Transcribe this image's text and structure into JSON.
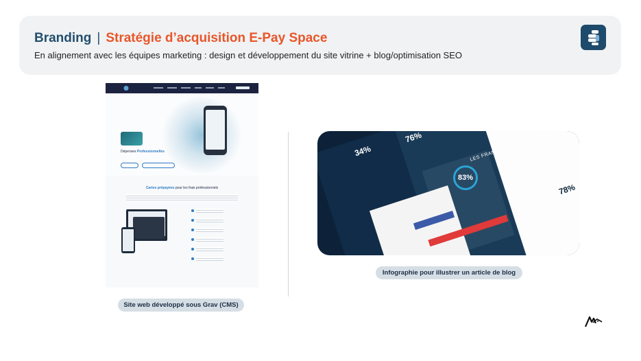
{
  "header": {
    "brand": "Branding",
    "separator": "|",
    "topic": "Stratégie d’acquisition E-Pay Space",
    "subtitle": "En alignement avec les équipes marketing : design et développement du site vitrine + blog/optimisation SEO"
  },
  "website_mockup": {
    "hero_title_plain": "Dépenses ",
    "hero_title_accent": "Professionnelles",
    "section_title_accent": "Cartes prépayées",
    "section_title_plain": " pour les frais professionnels",
    "caption": "Site web développé sous Grav (CMS)"
  },
  "infographic": {
    "stats": [
      "34%",
      "76%",
      "83%",
      "78%"
    ],
    "headline": "LES FRANÇAIS ET LES FINTECH",
    "caption": "Infographie pour illustrer un article de blog"
  },
  "colors": {
    "brand_blue": "#234f6e",
    "accent_orange": "#e8562a",
    "header_bg": "#f1f2f3",
    "caption_bg": "#d6dee5"
  }
}
